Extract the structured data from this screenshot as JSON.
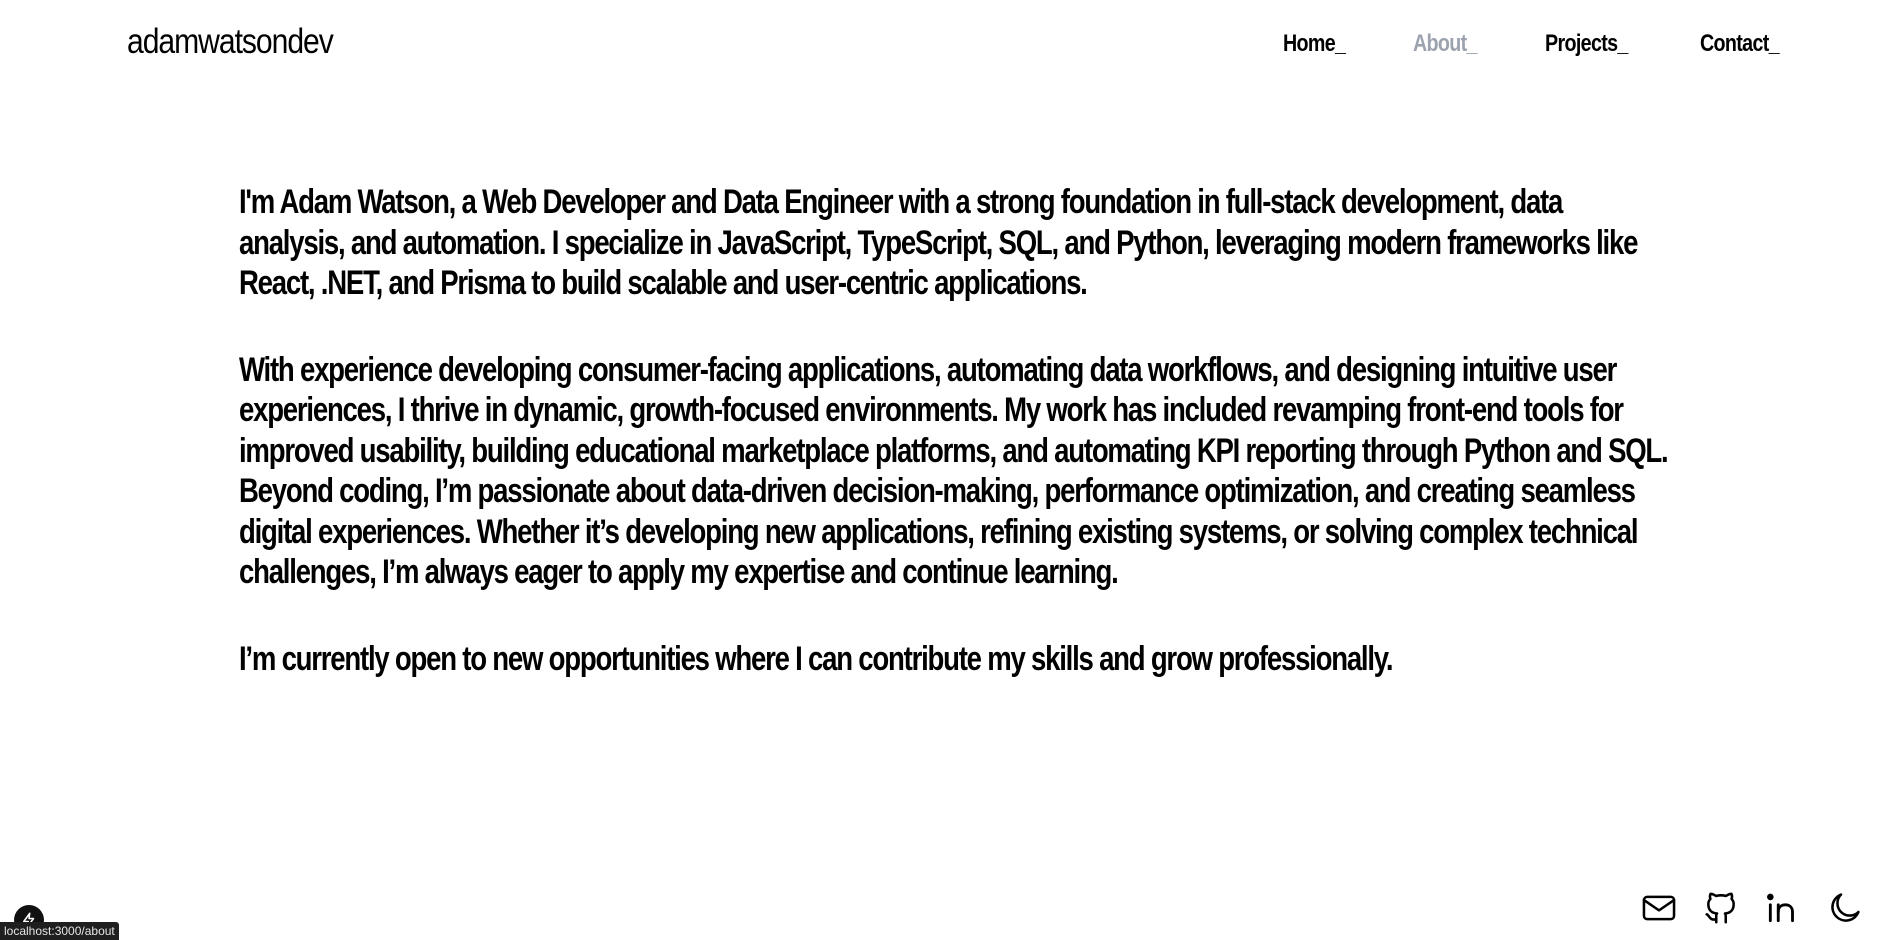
{
  "header": {
    "brand": "adamwatsondev",
    "nav": [
      {
        "label": "Home_",
        "active": false
      },
      {
        "label": "About_",
        "active": true
      },
      {
        "label": "Projects_",
        "active": false
      },
      {
        "label": "Contact_",
        "active": false
      }
    ]
  },
  "about": {
    "paragraphs": [
      "I'm Adam Watson, a Web Developer and Data Engineer with a strong foundation in full-stack development, data analysis, and automation. I specialize in JavaScript, TypeScript, SQL, and Python, leveraging modern frameworks like React, .NET, and Prisma to build scalable and user-centric applications.",
      "With experience developing consumer-facing applications, automating data workflows, and designing intuitive user experiences, I thrive in dynamic, growth-focused environments. My work has included revamping front-end tools for improved usability, building educational marketplace platforms, and automating KPI reporting through Python and SQL. Beyond coding, I’m passionate about data-driven decision-making, performance optimization, and creating seamless digital experiences. Whether it’s developing new applications, refining existing systems, or solving complex technical challenges, I’m always eager to apply my expertise and continue learning.",
      "I’m currently open to new opportunities where I can contribute my skills and grow professionally."
    ]
  },
  "footer": {
    "icons": [
      "mail-icon",
      "github-icon",
      "linkedin-icon",
      "moon-icon"
    ]
  },
  "dev_indicator": {
    "icon": "lightning-bolt-icon"
  },
  "status_bar": {
    "url": "localhost:3000/about"
  },
  "colors": {
    "text": "#000000",
    "background": "#ffffff",
    "nav_active": "#9ca3af",
    "status_bar_bg": "#1f1f1f"
  }
}
